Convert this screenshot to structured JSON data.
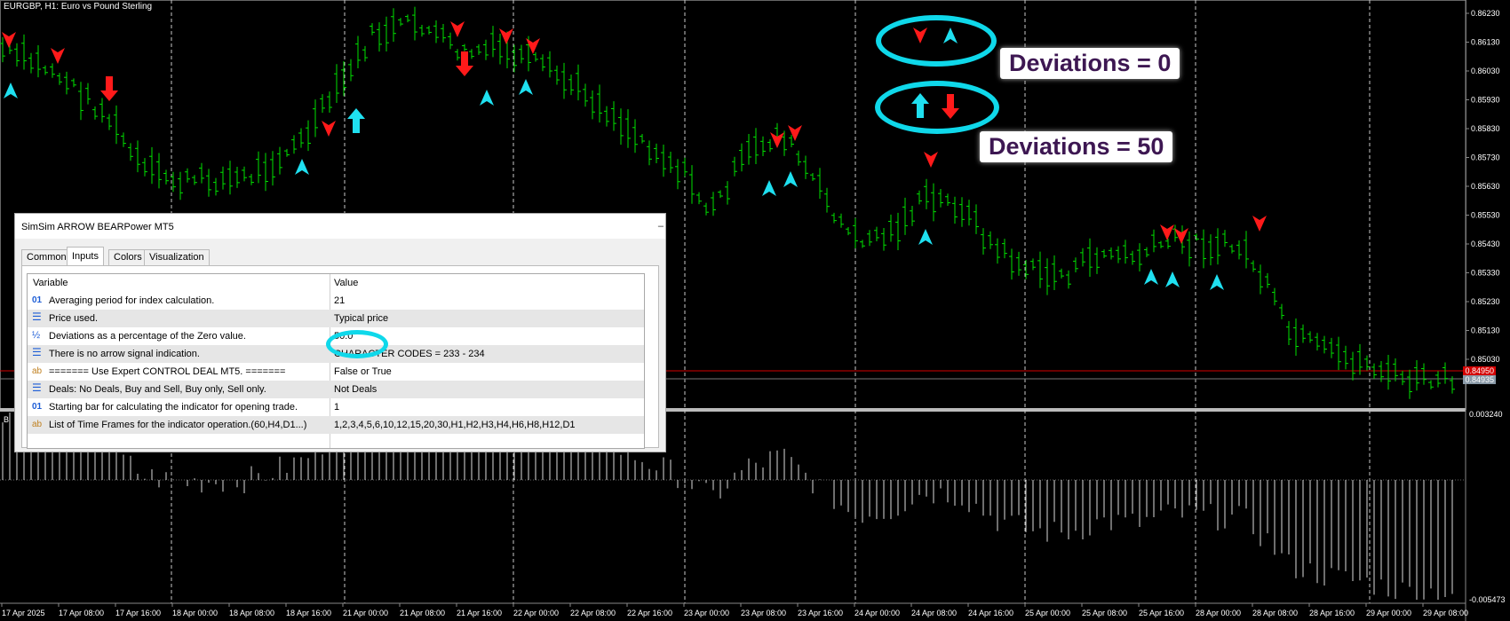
{
  "chart": {
    "symbol_label": "EURGBP, H1:  Euro vs Pound Sterling",
    "price_labels": [
      "0.86230",
      "0.86130",
      "0.86030",
      "0.85930",
      "0.85830",
      "0.85730",
      "0.85630",
      "0.85530",
      "0.85430",
      "0.85330",
      "0.85230",
      "0.85130",
      "0.85030"
    ],
    "current_price_red": "0.84950",
    "current_price_gray": "0.84935",
    "indicator_labels": [
      "0.003240",
      "-0.005473"
    ],
    "time_labels": [
      "17 Apr 2025",
      "17 Apr 08:00",
      "17 Apr 16:00",
      "18 Apr 00:00",
      "18 Apr 08:00",
      "18 Apr 16:00",
      "21 Apr 00:00",
      "21 Apr 08:00",
      "21 Apr 16:00",
      "22 Apr 00:00",
      "22 Apr 08:00",
      "22 Apr 16:00",
      "23 Apr 00:00",
      "23 Apr 08:00",
      "23 Apr 16:00",
      "24 Apr 00:00",
      "24 Apr 08:00",
      "24 Apr 16:00",
      "25 Apr 00:00",
      "25 Apr 08:00",
      "25 Apr 16:00",
      "28 Apr 00:00",
      "28 Apr 08:00",
      "28 Apr 16:00",
      "29 Apr 00:00",
      "29 Apr 08:00"
    ],
    "indicator_window_label": "B",
    "colors": {
      "background": "#000000",
      "bars": "#00e000",
      "grid": "#c8c8c8",
      "arrow_up": "#1fe0f0",
      "arrow_down": "#ff1a1a"
    }
  },
  "annotations": {
    "callout_zero": "Deviations = 0",
    "callout_fifty": "Deviations = 50"
  },
  "dialog": {
    "title": "SimSim ARROW BEARPower MT5",
    "close_icon": "close-icon",
    "tabs": [
      "Common",
      "Inputs",
      "Colors",
      "Visualization"
    ],
    "active_tab": "Inputs",
    "headers": {
      "variable": "Variable",
      "value": "Value"
    },
    "rows": [
      {
        "icon": "01",
        "variable": "Averaging period for index calculation.",
        "value": "21"
      },
      {
        "icon": "list",
        "variable": "Price used.",
        "value": "Typical price"
      },
      {
        "icon": "½",
        "variable": "Deviations as a percentage of the Zero value.",
        "value": "50.0"
      },
      {
        "icon": "list",
        "variable": "There is no arrow signal indication.",
        "value": "CHARACTER CODES = 233 - 234"
      },
      {
        "icon": "ab",
        "variable": "=======     Use Expert CONTROL DEAL MT5.     =======",
        "value": "False or True"
      },
      {
        "icon": "list",
        "variable": "Deals: No Deals, Buy and Sell, Buy only, Sell only.",
        "value": "Not Deals"
      },
      {
        "icon": "01",
        "variable": "Starting bar for calculating the indicator for opening trade.",
        "value": "1"
      },
      {
        "icon": "ab",
        "variable": "List of Time Frames for the indicator operation.(60,H4,D1...)",
        "value": "1,2,3,4,5,6,10,12,15,20,30,H1,H2,H3,H4,H6,H8,H12,D1"
      }
    ]
  }
}
